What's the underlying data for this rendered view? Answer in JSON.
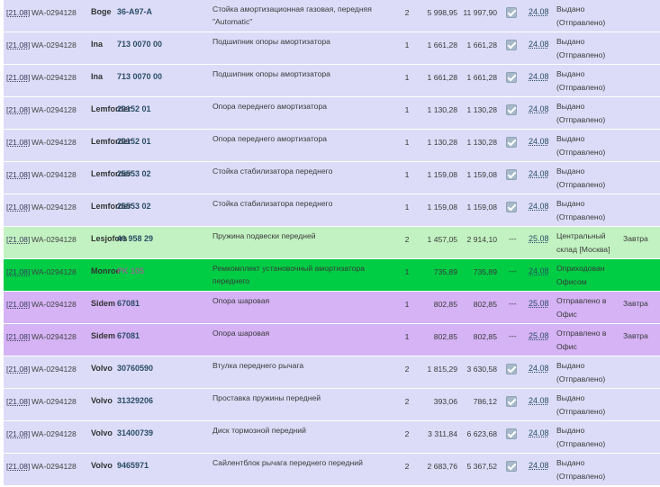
{
  "colors": {
    "lavender": "#dcdcf8",
    "lightgreen": "#c2f2c2",
    "green": "#00cc44",
    "violet": "#d5b3f5",
    "article_link": "#2b4d66",
    "checkbox": "#a7b9c9"
  },
  "rows": [
    {
      "date": "[21.08]",
      "order": "WA-0294128",
      "brand": "Boge",
      "article": "36-A97-A",
      "desc": "Стойка амортизационная газовая, передняя \"Automatic\"",
      "qty": "2",
      "price": "5 998,95",
      "total": "11 997,90",
      "delivery": "24.08",
      "status": "Выдано (Отправлено)",
      "eta": ""
    },
    {
      "date": "[21.08]",
      "order": "WA-0294128",
      "brand": "Ina",
      "article": "713 0070 00",
      "desc": "Подшипник опоры амортизатора",
      "qty": "1",
      "price": "1 661,28",
      "total": "1 661,28",
      "delivery": "24.08",
      "status": "Выдано (Отправлено)",
      "eta": ""
    },
    {
      "date": "[21.08]",
      "order": "WA-0294128",
      "brand": "Ina",
      "article": "713 0070 00",
      "desc": "Подшипник опоры амортизатора",
      "qty": "1",
      "price": "1 661,28",
      "total": "1 661,28",
      "delivery": "24.08",
      "status": "Выдано (Отправлено)",
      "eta": ""
    },
    {
      "date": "[21.08]",
      "order": "WA-0294128",
      "brand": "Lemforder",
      "article": "20152 01",
      "desc": "Опора переднего амортизатора",
      "qty": "1",
      "price": "1 130,28",
      "total": "1 130,28",
      "delivery": "24.08",
      "status": "Выдано (Отправлено)",
      "eta": ""
    },
    {
      "date": "[21.08]",
      "order": "WA-0294128",
      "brand": "Lemforder",
      "article": "20152 01",
      "desc": "Опора переднего амортизатора",
      "qty": "1",
      "price": "1 130,28",
      "total": "1 130,28",
      "delivery": "24.08",
      "status": "Выдано (Отправлено)",
      "eta": ""
    },
    {
      "date": "[21.08]",
      "order": "WA-0294128",
      "brand": "Lemforder",
      "article": "25553 02",
      "desc": "Стойка стабилизатора переднего",
      "qty": "1",
      "price": "1 159,08",
      "total": "1 159,08",
      "delivery": "24.08",
      "status": "Выдано (Отправлено)",
      "eta": ""
    },
    {
      "date": "[21.08]",
      "order": "WA-0294128",
      "brand": "Lemforder",
      "article": "25553 02",
      "desc": "Стойка стабилизатора переднего",
      "qty": "1",
      "price": "1 159,08",
      "total": "1 159,08",
      "delivery": "24.08",
      "status": "Выдано (Отправлено)",
      "eta": ""
    },
    {
      "date": "[21.08]",
      "order": "WA-0294128",
      "brand": "Lesjofors",
      "article": "40 958 29",
      "desc": "Пружина подвески передней",
      "qty": "2",
      "price": "1 457,05",
      "total": "2 914,10",
      "delivery": "25.08",
      "status": "Центральный склад [Москва]",
      "eta": "Завтра"
    },
    {
      "date": "[21.08]",
      "order": "WA-0294128",
      "brand": "Monroe",
      "article": "PK 105",
      "desc": "Ремкомплект установочный амортизатора переднего",
      "qty": "1",
      "price": "735,89",
      "total": "735,89",
      "delivery": "24.08",
      "status": "Оприходован Офисом",
      "eta": ""
    },
    {
      "date": "[21.08]",
      "order": "WA-0294128",
      "brand": "Sidem",
      "article": "67081",
      "desc": "Опора шаровая",
      "qty": "1",
      "price": "802,85",
      "total": "802,85",
      "delivery": "25.08",
      "status": "Отправлено в Офис",
      "eta": "Завтра"
    },
    {
      "date": "[21.08]",
      "order": "WA-0294128",
      "brand": "Sidem",
      "article": "67081",
      "desc": "Опора шаровая",
      "qty": "1",
      "price": "802,85",
      "total": "802,85",
      "delivery": "25.08",
      "status": "Отправлено в Офис",
      "eta": "Завтра"
    },
    {
      "date": "[21.08]",
      "order": "WA-0294128",
      "brand": "Volvo",
      "article": "30760590",
      "desc": "Втулка переднего рычага",
      "qty": "2",
      "price": "1 815,29",
      "total": "3 630,58",
      "delivery": "24.08",
      "status": "Выдано (Отправлено)",
      "eta": ""
    },
    {
      "date": "[21.08]",
      "order": "WA-0294128",
      "brand": "Volvo",
      "article": "31329206",
      "desc": "Проставка пружины передней",
      "qty": "2",
      "price": "393,06",
      "total": "786,12",
      "delivery": "24.08",
      "status": "Выдано (Отправлено)",
      "eta": ""
    },
    {
      "date": "[21.08]",
      "order": "WA-0294128",
      "brand": "Volvo",
      "article": "31400739",
      "desc": "Диск тормозной передний",
      "qty": "2",
      "price": "3 311,84",
      "total": "6 623,68",
      "delivery": "24.08",
      "status": "Выдано (Отправлено)",
      "eta": ""
    },
    {
      "date": "[21.08]",
      "order": "WA-0294128",
      "brand": "Volvo",
      "article": "9465971",
      "desc": "Сайлентблок рычага переднего передний",
      "qty": "2",
      "price": "2 683,76",
      "total": "5 367,52",
      "delivery": "24.08",
      "status": "Выдано (Отправлено)",
      "eta": ""
    }
  ],
  "row_marks": [
    "checkbox",
    "checkbox",
    "checkbox",
    "checkbox",
    "checkbox",
    "checkbox",
    "checkbox",
    "dash",
    "dash",
    "dash",
    "dash",
    "checkbox",
    "checkbox",
    "checkbox",
    "checkbox"
  ],
  "row_backgrounds": [
    "lavender",
    "lavender",
    "lavender",
    "lavender",
    "lavender",
    "lavender",
    "lavender",
    "lightgreen",
    "green",
    "violet",
    "violet",
    "lavender",
    "lavender",
    "lavender",
    "lavender"
  ],
  "dash_text": "---"
}
